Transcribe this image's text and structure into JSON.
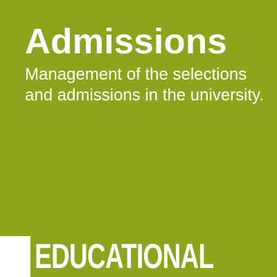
{
  "tile": {
    "title": "Admissions",
    "description": "Management of the selections and admissions in the university.",
    "category": "EDUCATIONAL",
    "colors": {
      "background": "#8ca51a",
      "text": "#ffffff",
      "marker": "#ffffff"
    }
  }
}
